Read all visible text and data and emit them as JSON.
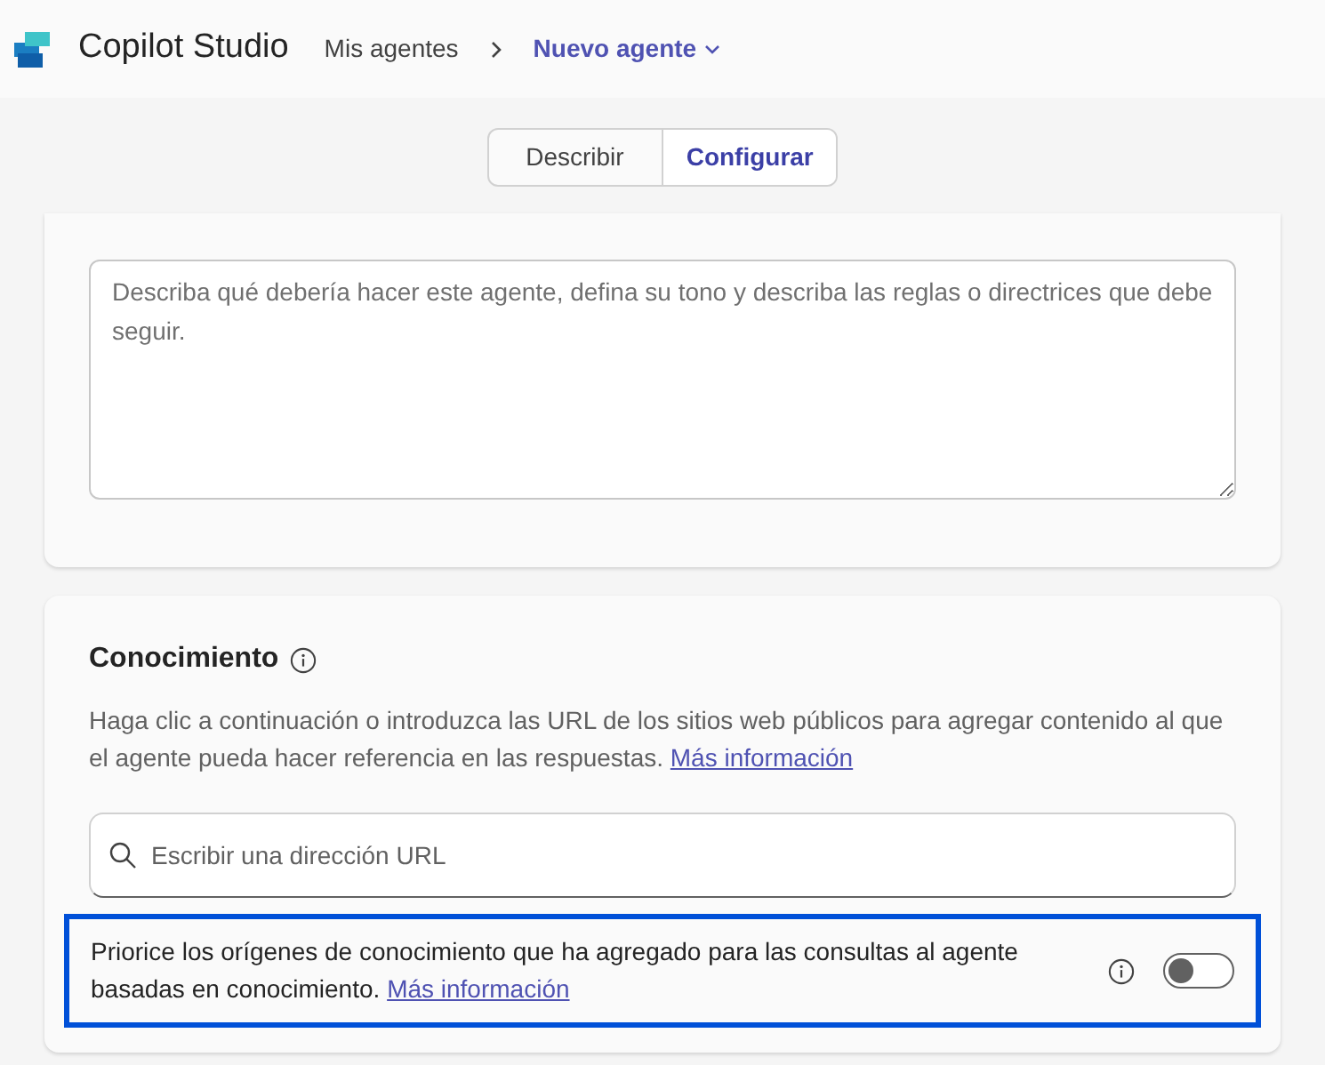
{
  "header": {
    "app_name": "Copilot Studio",
    "breadcrumb": [
      {
        "label": "Mis agentes"
      },
      {
        "label": "Nuevo agente"
      }
    ]
  },
  "tabs": [
    {
      "label": "Describir",
      "selected": false
    },
    {
      "label": "Configurar",
      "selected": true
    }
  ],
  "instructions": {
    "placeholder": "Describa qué debería hacer este agente, defina su tono y describa las reglas o directrices que debe seguir."
  },
  "knowledge": {
    "title": "Conocimiento",
    "description": "Haga clic a continuación o introduzca las URL de los sitios web públicos para agregar contenido al que el agente pueda hacer referencia en las respuestas.",
    "link": "Más información",
    "url_field": {
      "placeholder": "Escribir una dirección URL"
    },
    "prioritize": {
      "text": "Priorice los orígenes de conocimiento que ha agregado para las consultas al agente basadas en conocimiento.",
      "link": "Más información",
      "on": false,
      "highlighted": true
    }
  }
}
